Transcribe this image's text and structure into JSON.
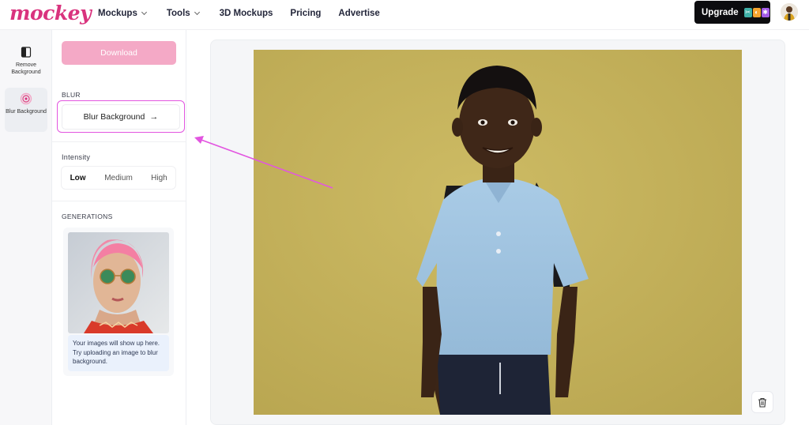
{
  "header": {
    "logo_text": "mockey",
    "nav": [
      {
        "label": "Mockups",
        "has_dropdown": true
      },
      {
        "label": "Tools",
        "has_dropdown": true
      },
      {
        "label": "3D Mockups",
        "has_dropdown": false
      },
      {
        "label": "Pricing",
        "has_dropdown": false
      },
      {
        "label": "Advertise",
        "has_dropdown": false
      }
    ],
    "upgrade_label": "Upgrade",
    "upgrade_icon_colors": [
      "#3fb0a7",
      "#f6a531",
      "#a45ce8"
    ]
  },
  "rail": {
    "items": [
      {
        "label": "Remove Background",
        "icon": "remove-background-icon",
        "active": false
      },
      {
        "label": "Blur Background",
        "icon": "blur-background-icon",
        "active": true
      }
    ]
  },
  "panel": {
    "download_label": "Download",
    "blur_section_label": "BLUR",
    "blur_button_label": "Blur Background",
    "intensity_label": "Intensity",
    "intensity_options": [
      "Low",
      "Medium",
      "High"
    ],
    "intensity_selected": "Low",
    "generations_label": "GENERATIONS",
    "generations_hint": "Your images will show up here. Try uploading an image to blur background."
  },
  "colors": {
    "brand": "#d9337e",
    "download_bg": "#f4a9c6",
    "highlight": "#e255e0",
    "photo_wall": "#c9b45c"
  }
}
